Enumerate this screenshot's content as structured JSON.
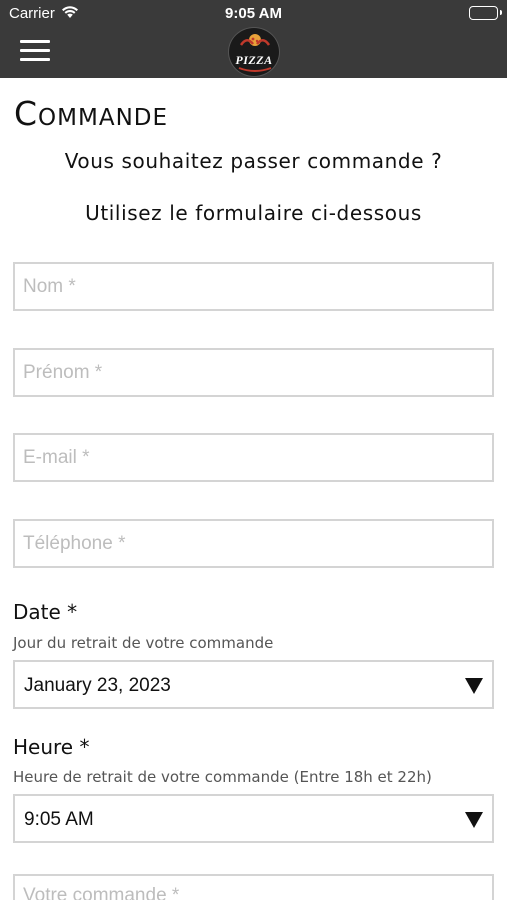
{
  "status_bar": {
    "carrier": "Carrier",
    "time": "9:05 AM",
    "icons": [
      "wifi-icon",
      "battery-icon"
    ]
  },
  "nav_bar": {
    "menu_icon": "hamburger-menu-icon",
    "logo_text": "PIZZA",
    "background_color": "#3a3a3a"
  },
  "page": {
    "title": "Commande",
    "lead_line_1": "Vous souhaitez passer commande ?",
    "lead_line_2": "Utilisez le formulaire ci-dessous"
  },
  "form": {
    "nom": {
      "placeholder": "Nom *",
      "value": ""
    },
    "prenom": {
      "placeholder": "Prénom *",
      "value": ""
    },
    "email": {
      "placeholder": "E-mail *",
      "value": ""
    },
    "telephone": {
      "placeholder": "Téléphone *",
      "value": ""
    },
    "date": {
      "label": "Date *",
      "hint": "Jour du retrait de votre commande",
      "selected": "January 23, 2023",
      "arrow_icon": "triangle-down-icon"
    },
    "heure": {
      "label": "Heure *",
      "hint": "Heure de retrait de votre commande (Entre 18h et 22h)",
      "selected": "9:05 AM",
      "arrow_icon": "triangle-down-icon"
    },
    "commande": {
      "placeholder": "Votre commande *",
      "value": ""
    }
  }
}
